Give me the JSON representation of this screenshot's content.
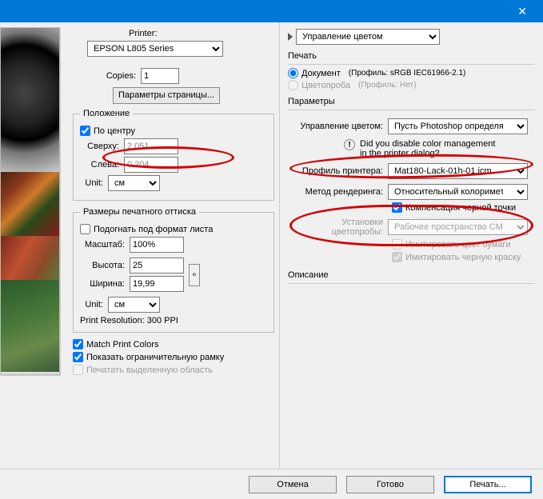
{
  "titlebar": {
    "close": "✕"
  },
  "left": {
    "printer_label": "Printer:",
    "printer_value": "EPSON L805 Series",
    "copies_label": "Copies:",
    "copies_value": "1",
    "page_setup": "Параметры страницы...",
    "position": {
      "legend": "Положение",
      "center": "По центру",
      "top_label": "Сверху:",
      "top_value": "2,051",
      "left_label": "Слева:",
      "left_value": "0,204",
      "unit_label": "Unit:",
      "unit_value": "см"
    },
    "size": {
      "legend": "Размеры печатного оттиска",
      "fit": "Подогнать под формат листа",
      "scale_label": "Масштаб:",
      "scale_value": "100%",
      "height_label": "Высота:",
      "height_value": "25",
      "width_label": "Ширина:",
      "width_value": "19,99",
      "unit_label": "Unit:",
      "unit_value": "см",
      "resolution": "Print Resolution: 300 PPI"
    },
    "match_colors": "Match Print Colors",
    "show_bbox": "Показать ограничительную рамку",
    "print_selection": "Печатать выделенную область"
  },
  "right": {
    "top_select": "Управление цветом",
    "print_section": "Печать",
    "doc": "Документ",
    "doc_profile": "(Профиль: sRGB IEC61966-2.1)",
    "proof": "Цветопроба",
    "proof_profile": "(Профиль: Нет)",
    "params": "Параметры",
    "color_mgmt_label": "Управление цветом:",
    "color_mgmt_value": "Пусть Photoshop определяет ...",
    "warn_text1": "Did you disable color management",
    "warn_text2": "in the printer dialog?",
    "printer_profile_label": "Профиль принтера:",
    "printer_profile_value": "Mat180-Lack-01h-01.icm",
    "rendering_label": "Метод рендеринга:",
    "rendering_value": "Относительный колориметр...",
    "black_point": "Компенсация черной точки",
    "proof_setup_label": "Установки цветопробы:",
    "proof_setup_value": "Рабочее пространство CMYK",
    "sim_paper": "Имитировать цвет бумаги",
    "sim_black": "Имитировать черную краску",
    "description": "Описание"
  },
  "buttons": {
    "cancel": "Отмена",
    "done": "Готово",
    "print": "Печать..."
  }
}
